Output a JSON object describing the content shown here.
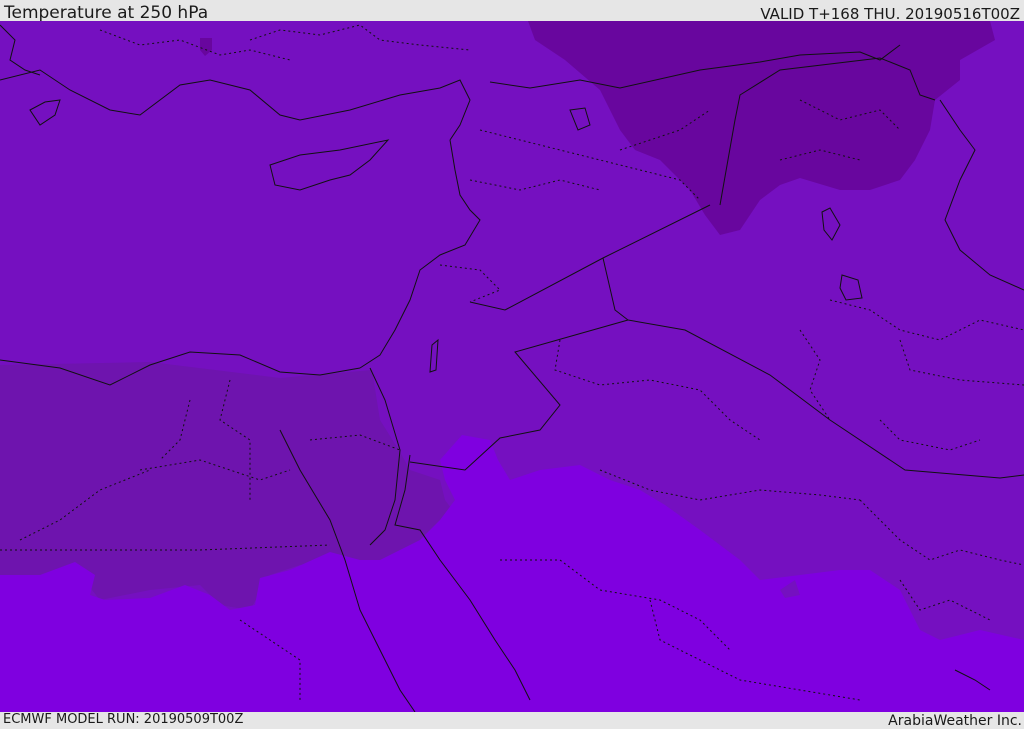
{
  "header": {
    "title": "Temperature at 250 hPa",
    "valid": "VALID T+168 THU. 20190516T00Z"
  },
  "footer": {
    "model_run": "ECMWF MODEL RUN: 20190509T00Z",
    "credit": "ArabiaWeather Inc."
  },
  "colors": {
    "band_warm": "#7f00e0",
    "band_mid": "#7510c0",
    "band_mid_dark": "#6e14ae",
    "band_cold": "#68069e",
    "coastline": "#111111",
    "border": "#111111"
  }
}
